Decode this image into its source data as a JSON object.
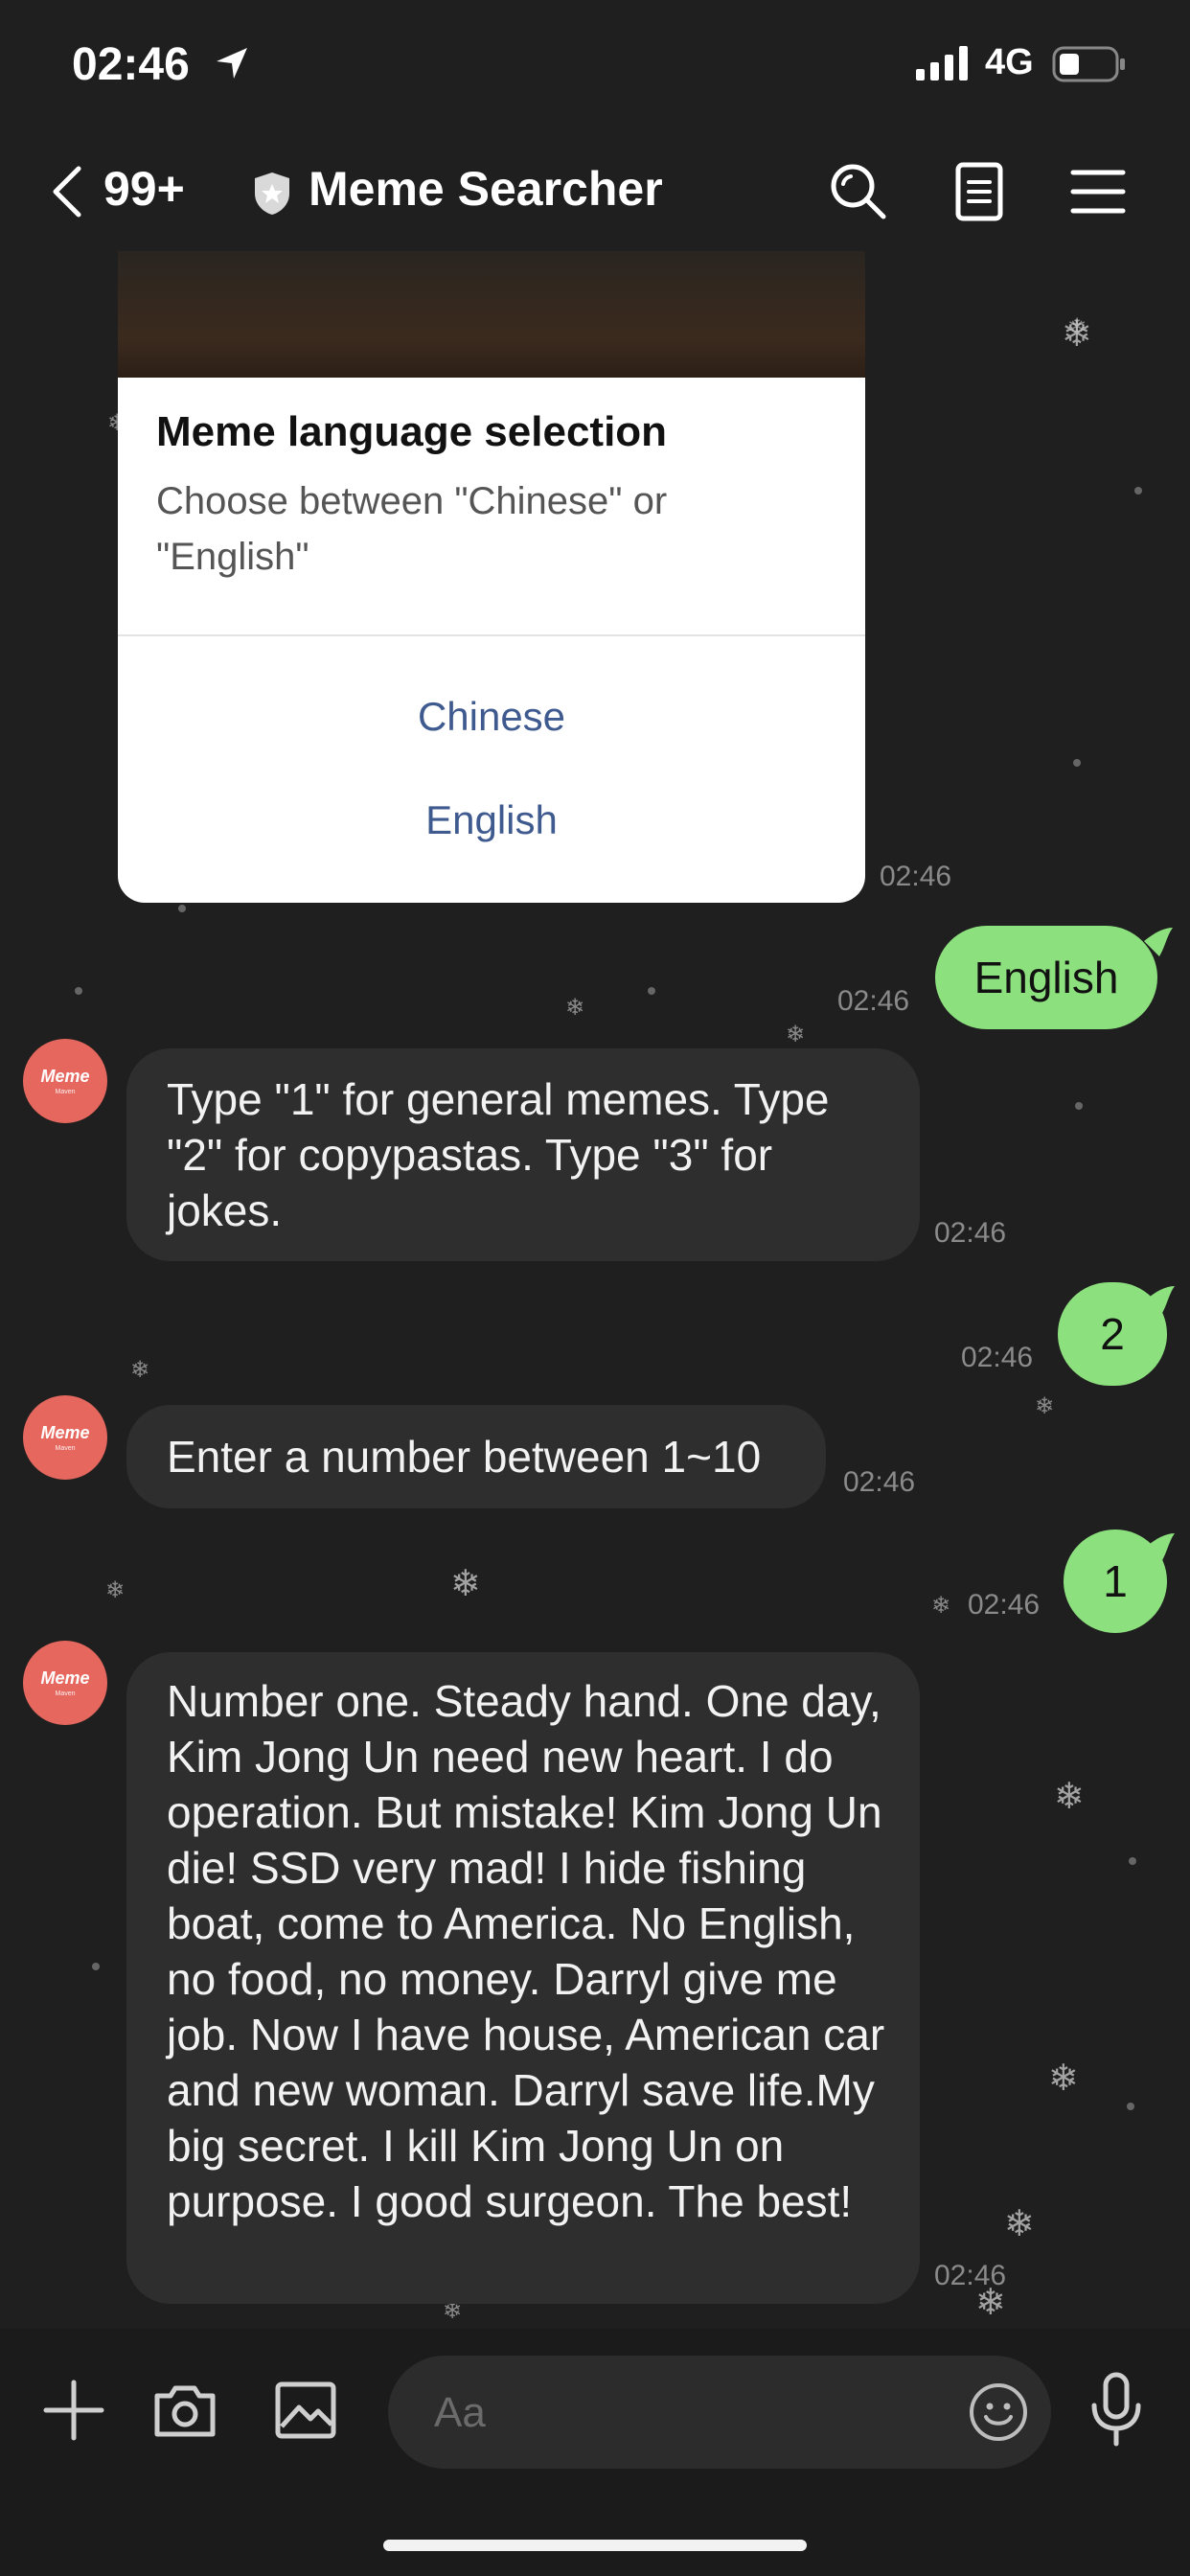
{
  "status": {
    "time": "02:46",
    "network": "4G"
  },
  "header": {
    "back_count": "99+",
    "title": "Meme Searcher"
  },
  "card": {
    "title": "Meme language selection",
    "description": "Choose between \"Chinese\" or \"English\"",
    "options": [
      "Chinese",
      "English"
    ],
    "timestamp": "02:46"
  },
  "messages": [
    {
      "from": "me",
      "text": "English",
      "time": "02:46"
    },
    {
      "from": "bot",
      "text": "Type \"1\" for general memes. Type \"2\" for copypastas. Type \"3\" for jokes.",
      "time": "02:46"
    },
    {
      "from": "me",
      "text": "2",
      "time": "02:46"
    },
    {
      "from": "bot",
      "text": "Enter a number between 1~10",
      "time": "02:46"
    },
    {
      "from": "me",
      "text": "1",
      "time": "02:46"
    },
    {
      "from": "bot",
      "text": "Number one. Steady hand. One day, Kim Jong Un need new heart. I do operation. But mistake! Kim Jong Un die! SSD very mad! I hide fishing boat, come to America. No English, no food, no money. Darryl give me job. Now I have house, American car and new woman. Darryl save life.My big secret. I kill Kim Jong Un on purpose. I good surgeon. The best!",
      "time": "02:46"
    }
  ],
  "bot_avatar": {
    "label": "Meme",
    "sublabel": "Maven"
  },
  "input": {
    "placeholder": "Aa"
  },
  "colors": {
    "background": "#1f1f1f",
    "outgoing_bubble": "#8ce07d",
    "incoming_bubble": "#2e2e2e",
    "avatar": "#e5675e",
    "option_link": "#3f5a8f"
  }
}
